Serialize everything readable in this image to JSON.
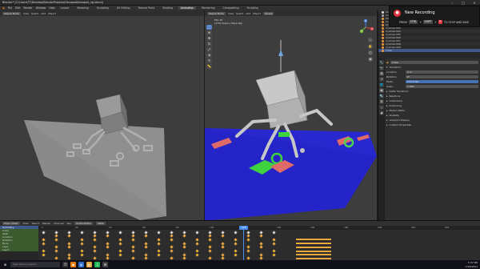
{
  "window": {
    "title": "Blender* [C:\\Users\\TT\\Desktop\\BlenderProjects\\Hexapod\\hexapod_rig.blend]"
  },
  "menu": {
    "items": [
      "File",
      "Edit",
      "Render",
      "Window",
      "Help"
    ],
    "tabs": [
      "Layout",
      "Modeling",
      "Sculpting",
      "UV Editing",
      "Texture Paint",
      "Shading",
      "Animation",
      "Rendering",
      "Compositing",
      "Scripting"
    ],
    "active_tab": "Animation"
  },
  "left_viewport": {
    "header": {
      "mode": "Object Mode",
      "view": "View",
      "select": "Select",
      "add": "Add",
      "object": "Object"
    }
  },
  "mid_viewport": {
    "header": {
      "mode": "Object Mode",
      "view": "View",
      "select": "Select",
      "add": "Add",
      "object": "Object",
      "transform": "Global"
    },
    "info": [
      "Fbx 10",
      "(173) Scene | Hexa Rig"
    ],
    "gizmo_axes": {
      "x": "X",
      "y": "Y",
      "z": "Z"
    }
  },
  "outliner": {
    "items": [
      "Scene Collection",
      "Collection",
      "Camera",
      "Cylinder.001",
      "Cylinder.002",
      "Cylinder.003",
      "Cylinder.004",
      "Cylinder.005",
      "Cylinder.006",
      "Cylinder.007",
      "Cylinder.008",
      "Cylinder.009",
      "Cube"
    ]
  },
  "properties": {
    "object_name": "Cube",
    "sections": [
      "Transform",
      "Delta Transform",
      "Relations",
      "Collections",
      "Instancing",
      "Motion Paths",
      "Visibility",
      "Viewport Display",
      "Custom Properties"
    ],
    "fields": [
      {
        "label": "Location",
        "value": "0 m"
      },
      {
        "label": "Rotation",
        "value": "0°"
      },
      {
        "label": "Mode",
        "value": "XYZ Euler"
      },
      {
        "label": "Scale",
        "value": "1.000"
      }
    ]
  },
  "dopesheet": {
    "header": {
      "editor": "Dope Sheet",
      "view": "View",
      "select": "Select",
      "marker": "Marker",
      "channel": "Channel",
      "key": "Key",
      "mode": "Action Editor",
      "action": "Walk"
    },
    "channels": [
      "Summary",
      "Cube",
      "Walk",
      "Location",
      "Rotation",
      "Bone",
      "Leg.L",
      "Leg.R"
    ],
    "current_frame": "118",
    "ruler": [
      "0",
      "20",
      "40",
      "60",
      "80",
      "100",
      "120",
      "140",
      "160",
      "180",
      "200",
      "220",
      "240"
    ]
  },
  "playback": {
    "playback": "Playback",
    "keying": "Keying",
    "view": "View",
    "marker": "Marker",
    "start": "Start 1",
    "end": "End 250"
  },
  "taskbar": {
    "search_placeholder": "Type here to search",
    "time": "5:37 PM",
    "date": "7/16/2021"
  },
  "recording": {
    "title": "New Recording",
    "press": "PRESS",
    "ctrl": "CTRL",
    "shift": "SHIFT",
    "key": "R",
    "tail": "TO STOP AND SAVE"
  },
  "colors": {
    "accent": "#4772b3",
    "keyframe": "#e8a83b",
    "rec": "#e0333b",
    "ground": "#2222cc"
  }
}
